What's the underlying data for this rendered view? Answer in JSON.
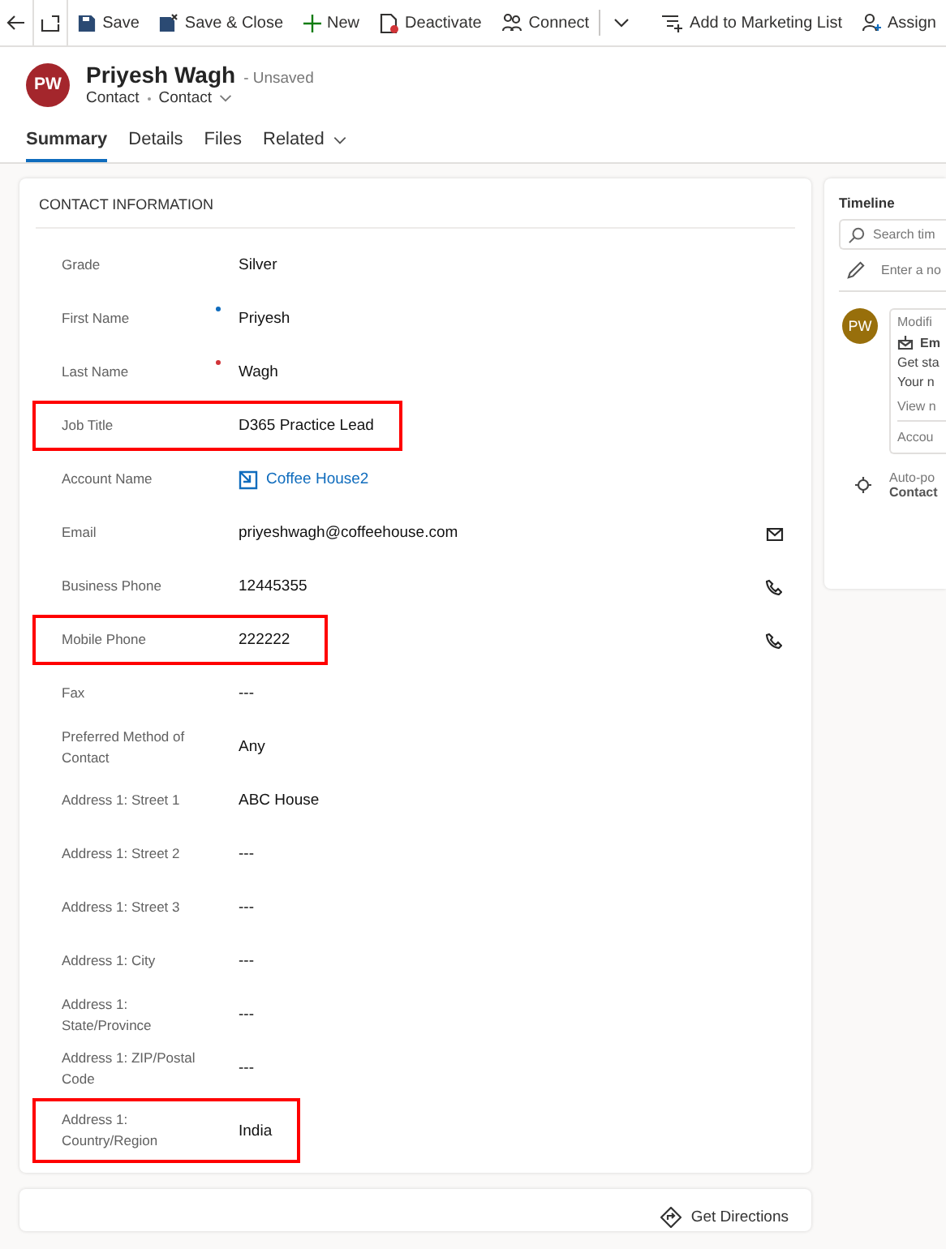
{
  "toolbar": [
    {
      "kind": "back"
    },
    {
      "kind": "popout"
    },
    {
      "kind": "save",
      "label": "Save"
    },
    {
      "kind": "save-close",
      "label": "Save & Close"
    },
    {
      "kind": "new",
      "label": "New"
    },
    {
      "kind": "deactivate",
      "label": "Deactivate"
    },
    {
      "kind": "connect",
      "label": "Connect"
    },
    {
      "kind": "more"
    },
    {
      "kind": "list",
      "label": "Add to Marketing List"
    },
    {
      "kind": "assign",
      "label": "Assign"
    }
  ],
  "header": {
    "initials": "PW",
    "name": "Priyesh Wagh",
    "status": "- Unsaved",
    "entity": "Contact",
    "form": "Contact"
  },
  "tabs": [
    {
      "label": "Summary",
      "selected": true
    },
    {
      "label": "Details",
      "selected": false
    },
    {
      "label": "Files",
      "selected": false
    },
    {
      "label": "Related",
      "selected": false,
      "dropdown": true
    }
  ],
  "section": {
    "title": "CONTACT INFORMATION",
    "fields": [
      {
        "label": "Grade",
        "value": "Silver",
        "kind": "text",
        "highlighted": false
      },
      {
        "label": "First Name",
        "value": "Priyesh",
        "kind": "text",
        "recommended": true,
        "highlighted": false
      },
      {
        "label": "Last Name",
        "value": "Wagh",
        "kind": "text",
        "required": true,
        "highlighted": false
      },
      {
        "label": "Job Title",
        "value": "D365 Practice Lead",
        "kind": "text",
        "highlighted": true
      },
      {
        "label": "Account Name",
        "value": "Coffee House2",
        "kind": "link",
        "highlighted": false
      },
      {
        "label": "Email",
        "value": "priyeshwagh@coffeehouse.com",
        "kind": "email",
        "highlighted": false
      },
      {
        "label": "Business Phone",
        "value": "12445355",
        "kind": "phone",
        "highlighted": false
      },
      {
        "label": "Mobile Phone",
        "value": "222222",
        "kind": "phone",
        "highlighted": true
      },
      {
        "label": "Fax",
        "value": "---",
        "kind": "text",
        "highlighted": false
      },
      {
        "label": "Preferred Method of Contact",
        "value": "Any",
        "kind": "text",
        "highlighted": false
      },
      {
        "label": "Address 1: Street 1",
        "value": "ABC House",
        "kind": "text",
        "highlighted": false
      },
      {
        "label": "Address 1: Street 2",
        "value": "---",
        "kind": "text",
        "highlighted": false
      },
      {
        "label": "Address 1: Street 3",
        "value": "---",
        "kind": "text",
        "highlighted": false
      },
      {
        "label": "Address 1: City",
        "value": "---",
        "kind": "text",
        "highlighted": false
      },
      {
        "label": "Address 1: State/Province",
        "value": "---",
        "kind": "text",
        "highlighted": false
      },
      {
        "label": "Address 1: ZIP/Postal Code",
        "value": "---",
        "kind": "text",
        "highlighted": false
      },
      {
        "label": "Address 1: Country/Region",
        "value": "India",
        "kind": "text",
        "highlighted": true
      }
    ]
  },
  "map_card": {
    "button": "Get Directions"
  },
  "timeline": {
    "title": "Timeline",
    "search_placeholder": "Search tim",
    "note_placeholder": "Enter a no",
    "entry": {
      "initials": "PW",
      "title": "Modifi",
      "subject": "Em",
      "body": [
        "Get sta",
        "Your n"
      ],
      "link": "View n",
      "footer": "Accou"
    },
    "auto_post": {
      "title": "Auto-po",
      "subtitle": "Contact"
    }
  }
}
